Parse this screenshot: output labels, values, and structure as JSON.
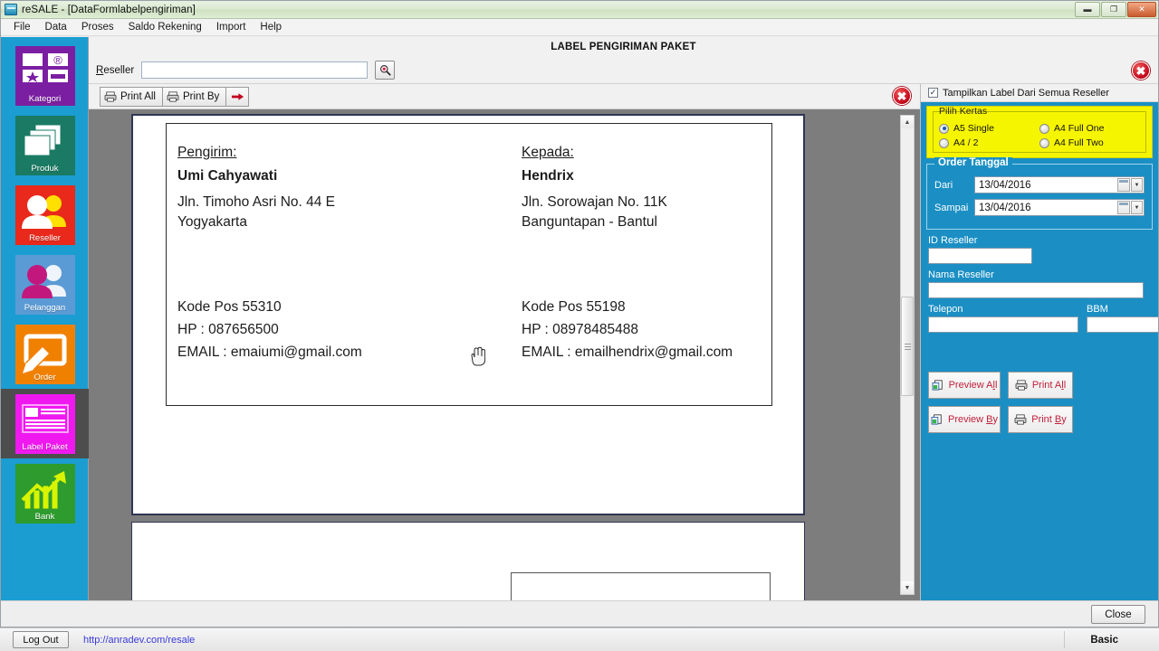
{
  "window": {
    "title": "reSALE - [DataFormlabelpengiriman]",
    "app_icon": "app-icon",
    "minimize": "—",
    "maximize": "▢",
    "close": "✕"
  },
  "menubar": {
    "items": [
      {
        "label": "File"
      },
      {
        "label": "Data"
      },
      {
        "label": "Proses"
      },
      {
        "label": "Saldo Rekening"
      },
      {
        "label": "Import"
      },
      {
        "label": "Help"
      }
    ]
  },
  "sidebar": {
    "items": [
      {
        "label": "Kategori",
        "icon": "category-icon",
        "color": "#7b1fa2",
        "selected": false
      },
      {
        "label": "Produk",
        "icon": "product-icon",
        "color": "#1a7a63",
        "selected": false
      },
      {
        "label": "Reseller",
        "icon": "reseller-icon",
        "color": "#e8291b",
        "selected": false
      },
      {
        "label": "Pelanggan",
        "icon": "customer-icon",
        "color": "#5b9bd5",
        "selected": false
      },
      {
        "label": "Order",
        "icon": "order-icon",
        "color": "#f08000",
        "selected": false
      },
      {
        "label": "Label Paket",
        "icon": "label-icon",
        "color": "#ef19ef",
        "selected": true
      },
      {
        "label": "Bank",
        "icon": "bank-icon",
        "color": "#2e9b2e",
        "selected": false
      }
    ]
  },
  "form": {
    "title": "LABEL PENGIRIMAN PAKET",
    "reseller_label": "Reseller",
    "reseller_value": "",
    "reseller_placeholder": "",
    "search_icon": "search-icon",
    "close_icon": "close-circle-icon"
  },
  "preview_toolbar": {
    "buttons": [
      {
        "label": "Print All",
        "icon": "printer-icon"
      },
      {
        "label": "Print By",
        "icon": "printer-icon"
      }
    ],
    "export_icon": "arrow-right-icon",
    "close_icon": "close-circle-icon"
  },
  "label": {
    "sender": {
      "heading": "Pengirim:",
      "name": "Umi Cahyawati",
      "street": "Jln. Timoho Asri No. 44 E",
      "city": "Yogyakarta",
      "postcode": "Kode Pos 55310",
      "phone": "HP : 087656500",
      "email": "EMAIL : emaiumi@gmail.com"
    },
    "recipient": {
      "heading": "Kepada:",
      "name": "Hendrix",
      "street": "Jln. Sorowajan No. 11K",
      "city": "Banguntapan - Bantul",
      "postcode": "Kode Pos 55198",
      "phone": "HP : 08978485488",
      "email": "EMAIL : emailhendrix@gmail.com"
    }
  },
  "scrollbar": {
    "up_arrow": "▲",
    "down_arrow": "▼",
    "thumb": "scroll-thumb"
  },
  "right_panel": {
    "show_all_checkbox": {
      "label": "Tampilkan Label Dari Semua Reseller",
      "checked": true,
      "mark": "✓"
    },
    "paper_group": {
      "title": "Pilih Kertas",
      "options": [
        {
          "label": "A5 Single",
          "selected": true
        },
        {
          "label": "A4 Full One",
          "selected": false
        },
        {
          "label": "A4 / 2",
          "selected": false
        },
        {
          "label": "A4 Full Two",
          "selected": false
        }
      ],
      "bg_color": "#f6f500"
    },
    "order_date_group": {
      "title": "Order Tanggal",
      "from_label": "Dari",
      "from_value": "13/04/2016",
      "to_label": "Sampai",
      "to_value": "13/04/2016",
      "calendar_icon": "calendar-icon",
      "dropdown_icon": "chevron-down-icon"
    },
    "fields": {
      "id_reseller_label": "ID Reseller",
      "id_reseller_value": "",
      "nama_reseller_label": "Nama Reseller",
      "nama_reseller_value": "",
      "telepon_label": "Telepon",
      "telepon_value": "",
      "bbm_label": "BBM",
      "bbm_value": ""
    },
    "actions": [
      {
        "label": "Preview All",
        "icon": "preview-icon"
      },
      {
        "label": "Print All",
        "icon": "printer-icon"
      },
      {
        "label": "Preview By",
        "icon": "preview-icon"
      },
      {
        "label": "Print By",
        "icon": "printer-icon"
      }
    ]
  },
  "footer": {
    "close_button": "Close"
  },
  "statusbar": {
    "logout": "Log Out",
    "url": "http://anradev.com/resale",
    "mode": "Basic"
  },
  "colors": {
    "sidebar_bg": "#1b9dd1",
    "panel_blue": "#1b8fc4",
    "highlight_yellow": "#f6f500",
    "accent_red": "#c0203a"
  }
}
